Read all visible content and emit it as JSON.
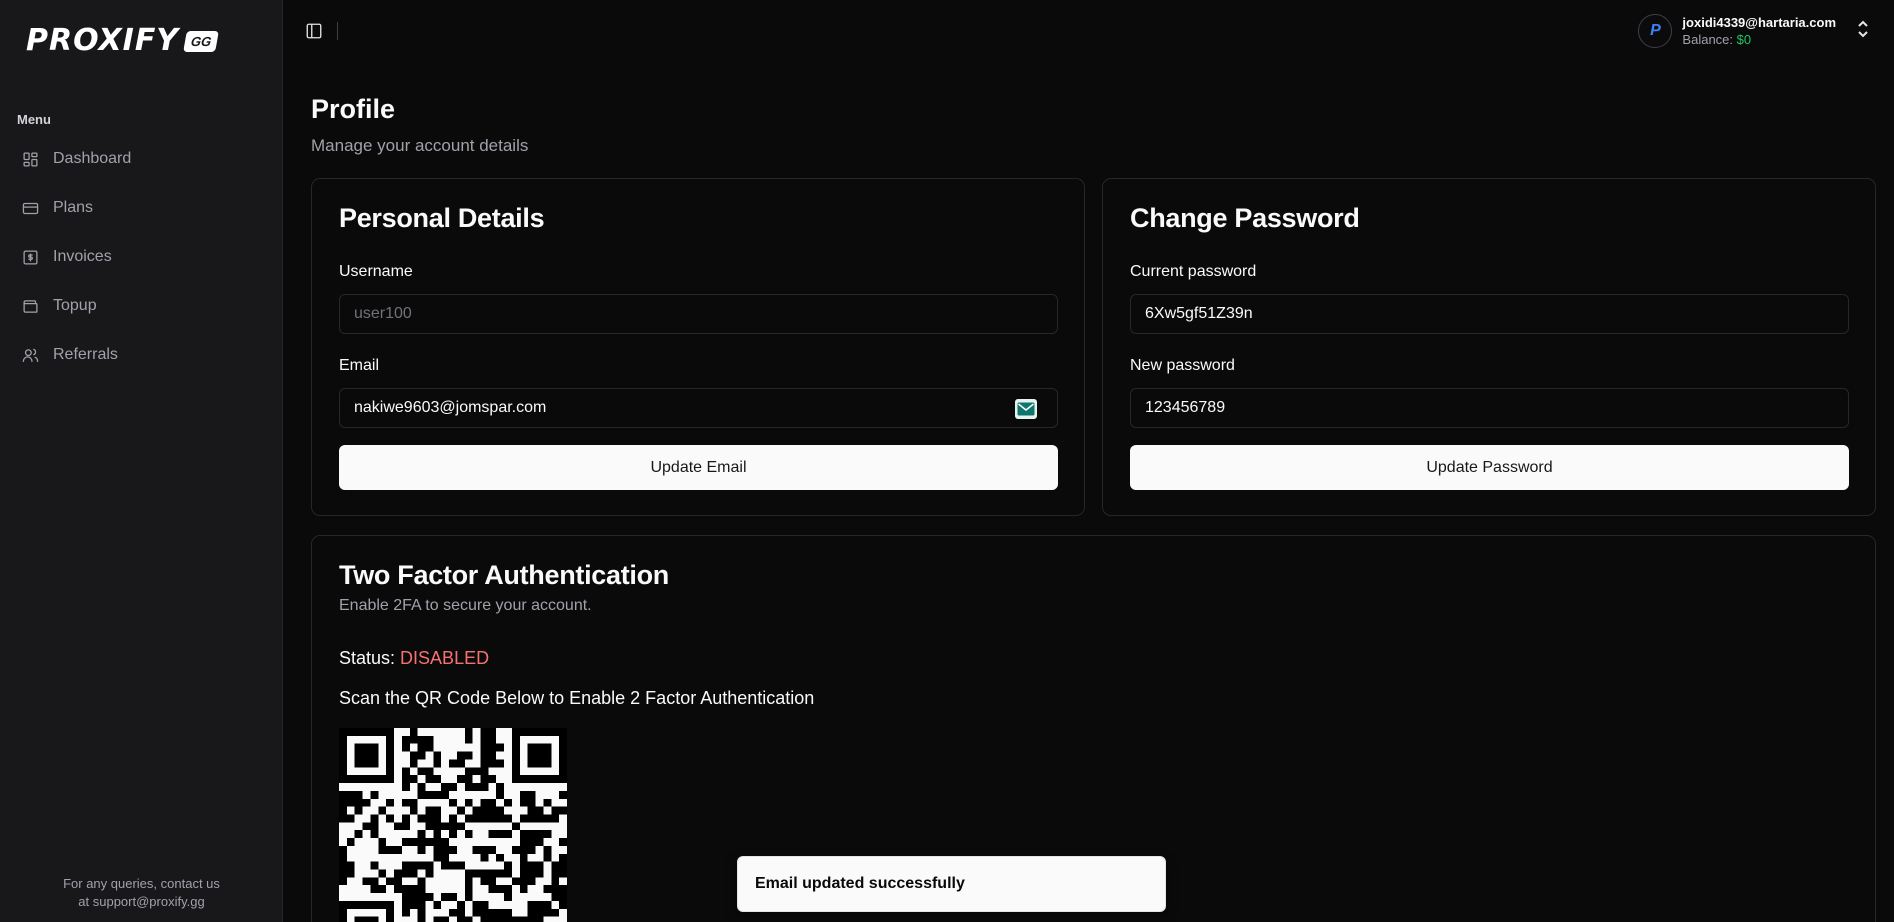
{
  "brand": {
    "name": "PROXIFY",
    "suffix": "GG"
  },
  "sidebar": {
    "menu_label": "Menu",
    "items": [
      {
        "label": "Dashboard",
        "icon": "dashboard-icon"
      },
      {
        "label": "Plans",
        "icon": "card-icon"
      },
      {
        "label": "Invoices",
        "icon": "invoice-icon"
      },
      {
        "label": "Topup",
        "icon": "wallet-icon"
      },
      {
        "label": "Referrals",
        "icon": "users-icon"
      }
    ],
    "footer_line1": "For any queries, contact us",
    "footer_line2": "at support@proxify.gg"
  },
  "header": {
    "user_email": "joxidi4339@hartaria.com",
    "balance_label": "Balance:",
    "balance_value": "$0",
    "avatar_letter": "P"
  },
  "page": {
    "title": "Profile",
    "subtitle": "Manage your account details"
  },
  "personal": {
    "title": "Personal Details",
    "username_label": "Username",
    "username_placeholder": "user100",
    "email_label": "Email",
    "email_value": "nakiwe9603@jomspar.com",
    "button": "Update Email"
  },
  "password": {
    "title": "Change Password",
    "current_label": "Current password",
    "current_value": "6Xw5gf51Z39n",
    "new_label": "New password",
    "new_value": "123456789",
    "button": "Update Password"
  },
  "twofa": {
    "title": "Two Factor Authentication",
    "subtitle": "Enable 2FA to secure your account.",
    "status_label": "Status:",
    "status_value": "DISABLED",
    "status_color": "#f87171",
    "scan_text": "Scan the QR Code Below to Enable 2 Factor Authentication"
  },
  "toast": {
    "message": "Email updated successfully"
  },
  "colors": {
    "accent": "#22c55e",
    "danger": "#f87171",
    "surface": "#18181b"
  }
}
